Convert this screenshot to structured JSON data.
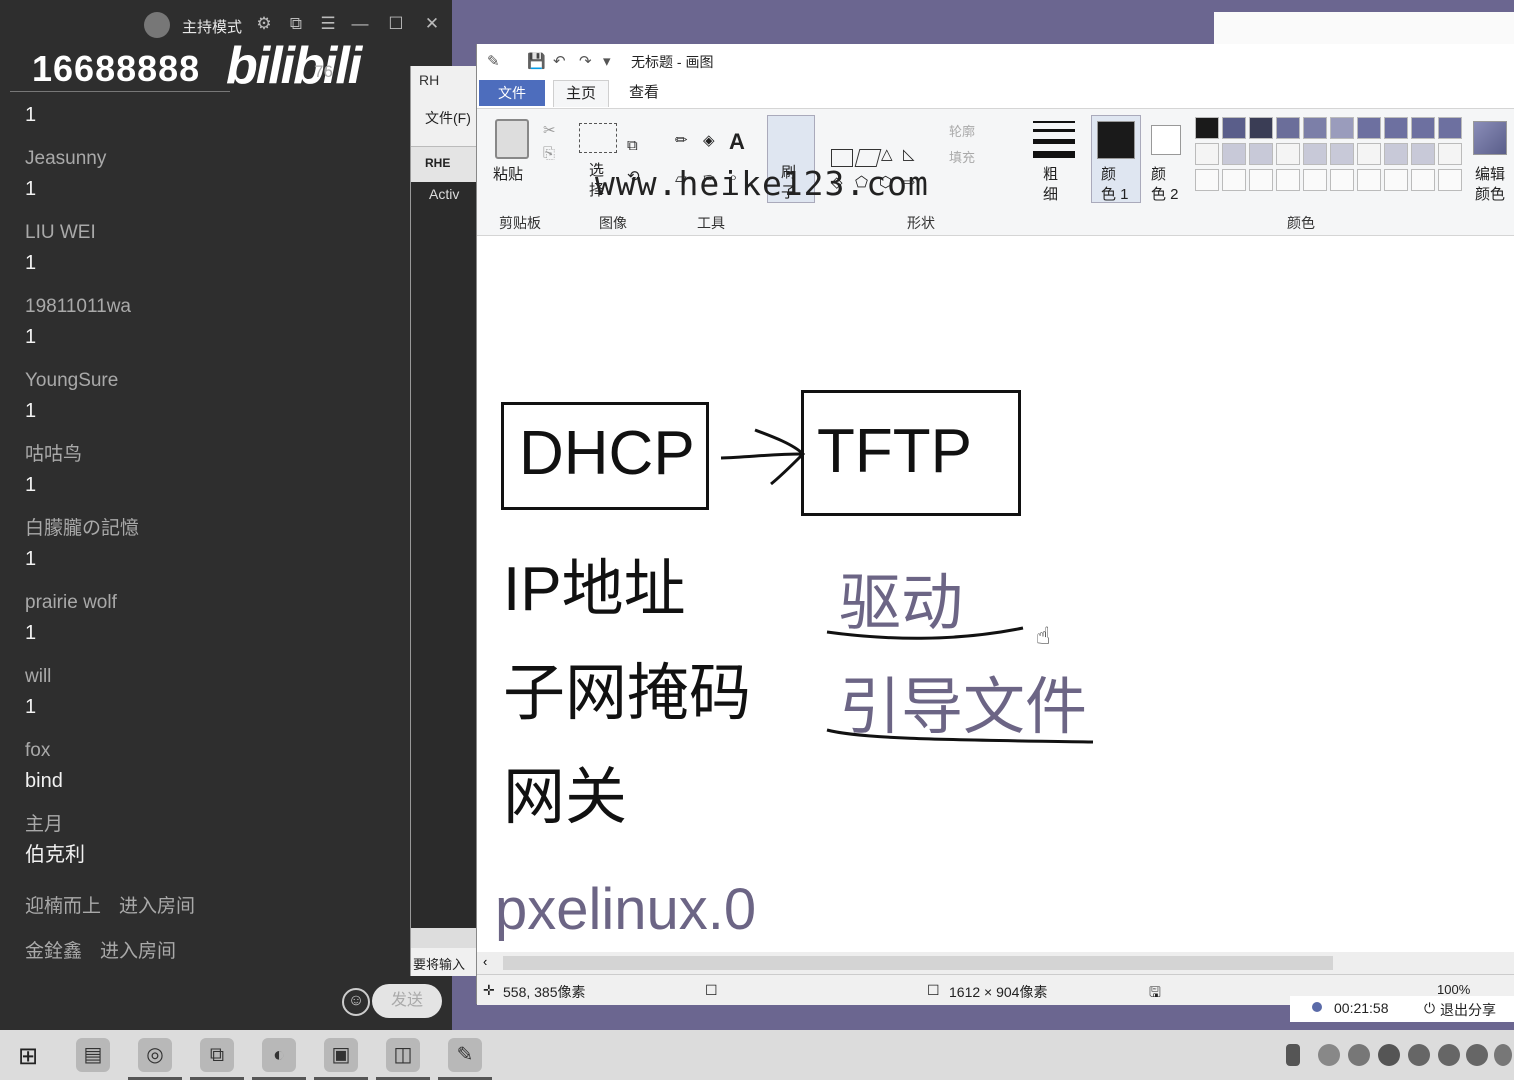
{
  "chat": {
    "host_mode": "主持模式",
    "room_number": "16688888",
    "logo": "bilibili",
    "logo_sub": "76",
    "messages": [
      {
        "name": "",
        "text": "1"
      },
      {
        "name": "Jeasunny",
        "text": "1"
      },
      {
        "name": "LIU WEI",
        "text": "1"
      },
      {
        "name": "19811011wa",
        "text": "1"
      },
      {
        "name": "YoungSure",
        "text": "1"
      },
      {
        "name": "咕咕鸟",
        "text": "1"
      },
      {
        "name": "白朦朧の記憶",
        "text": "1"
      },
      {
        "name": "prairie wolf",
        "text": "1"
      },
      {
        "name": "will",
        "text": "1"
      },
      {
        "name": "fox",
        "text": "bind"
      },
      {
        "name": "主月",
        "text": "伯克利"
      }
    ],
    "system": [
      {
        "user": "迎楠而上",
        "action": "进入房间"
      },
      {
        "user": "金銓鑫",
        "action": "进入房间"
      }
    ],
    "send_label": "发送"
  },
  "vm_window": {
    "title": "RH",
    "menu_file": "文件(F)",
    "tab": "RHE",
    "dark_text": "Activ",
    "status": "要将输入"
  },
  "paint": {
    "title": "无标题 - 画图",
    "tabs": {
      "file": "文件",
      "home": "主页",
      "view": "查看"
    },
    "watermark": "www.heike123.com",
    "ribbon": {
      "paste": "粘贴",
      "select": "选\n择",
      "brush": "刷\n子",
      "outline": "轮廓",
      "fill": "填充",
      "size": "粗\n细",
      "color1": "颜\n色 1",
      "color2": "颜\n色 2",
      "edit_colors": "编辑\n颜色",
      "groups": {
        "clipboard": "剪贴板",
        "image": "图像",
        "tools": "工具",
        "shapes": "形状",
        "colors": "颜色"
      }
    },
    "palette_colors": [
      "#1a1a1a",
      "#5a5e8a",
      "#3a3d55",
      "#6b6e9a",
      "#7c7fa8",
      "#9a9cbc",
      "#6d70a0",
      "#6d70a0",
      "#6d70a0",
      "#6d70a0"
    ],
    "canvas": {
      "box1": "DHCP",
      "box2": "TFTP",
      "items_left": [
        "IP地址",
        "子网掩码",
        "网关"
      ],
      "items_right": [
        "驱动",
        "引导文件"
      ],
      "bottom": "pxelinux.0"
    },
    "status": {
      "cursor": "558, 385像素",
      "size": "1612 × 904像素",
      "zoom": "100%"
    }
  },
  "share": {
    "time": "00:21:58",
    "exit": "退出分享"
  }
}
